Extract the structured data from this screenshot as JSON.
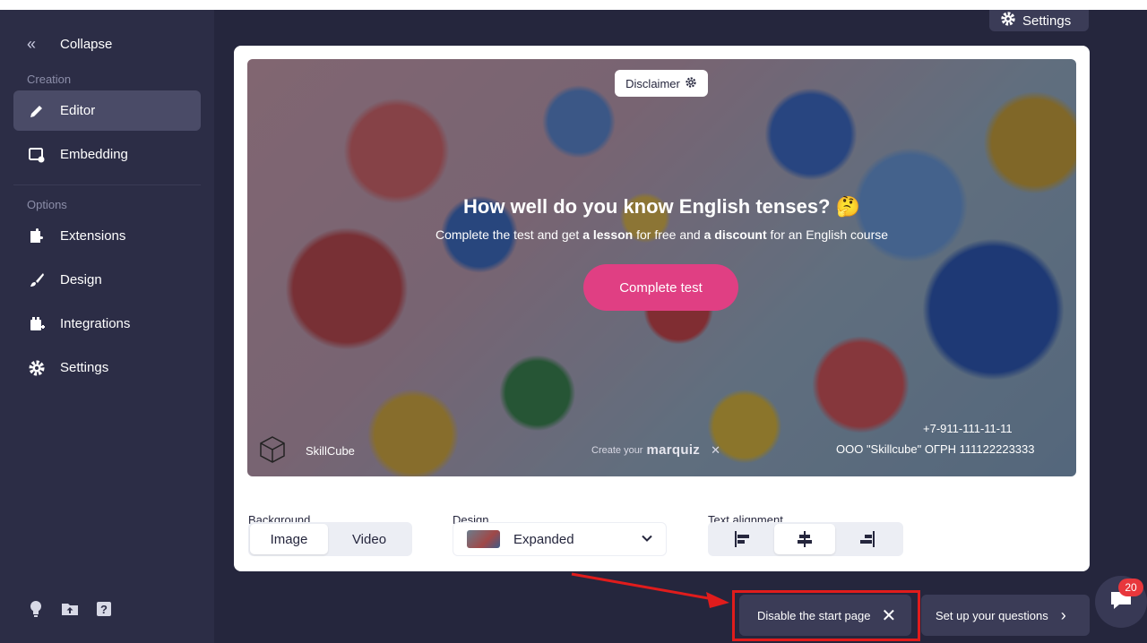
{
  "sidebar": {
    "collapse_label": "Collapse",
    "sections": [
      {
        "label": "Creation"
      },
      {
        "label": "Options"
      }
    ],
    "items": [
      {
        "label": "Editor",
        "icon": "pencil-icon",
        "active": true
      },
      {
        "label": "Embedding",
        "icon": "embed-icon"
      },
      {
        "label": "Extensions",
        "icon": "puzzle-icon"
      },
      {
        "label": "Design",
        "icon": "brush-icon"
      },
      {
        "label": "Integrations",
        "icon": "plug-icon"
      },
      {
        "label": "Settings",
        "icon": "gear-icon"
      }
    ],
    "bottom_icons": [
      "lightbulb-icon",
      "folder-upload-icon",
      "help-icon"
    ]
  },
  "top_settings_label": "Settings",
  "preview": {
    "disclaimer_label": "Disclaimer",
    "headline": "How well do you know English tenses? 🤔",
    "subline_parts": [
      "Complete the test and get ",
      "a lesson",
      " for free and ",
      "a discount",
      " for an English course"
    ],
    "cta_label": "Complete test",
    "brand_name": "SkillCube",
    "created_prefix": "Create your",
    "created_brand": "marquiz",
    "phone": "+7-911-111-11-11",
    "company": "ООО \"Skillcube\" ОГРН 111122223333"
  },
  "controls": {
    "background_label": "Background",
    "background_options": [
      "Image",
      "Video"
    ],
    "background_selected": "Image",
    "design_label": "Design",
    "design_value": "Expanded",
    "alignment_label": "Text alignment",
    "alignment_options": [
      "align-left-icon",
      "align-center-icon",
      "align-right-icon"
    ],
    "alignment_selected": "align-center-icon"
  },
  "actions": {
    "disable_label": "Disable the start page",
    "next_label": "Set up your questions"
  },
  "chat_badge": "20",
  "colors": {
    "sidebar_bg": "#2c2d46",
    "app_bg": "#25263d",
    "accent_pink": "#e03f83",
    "highlight_red": "#e01c1c"
  }
}
